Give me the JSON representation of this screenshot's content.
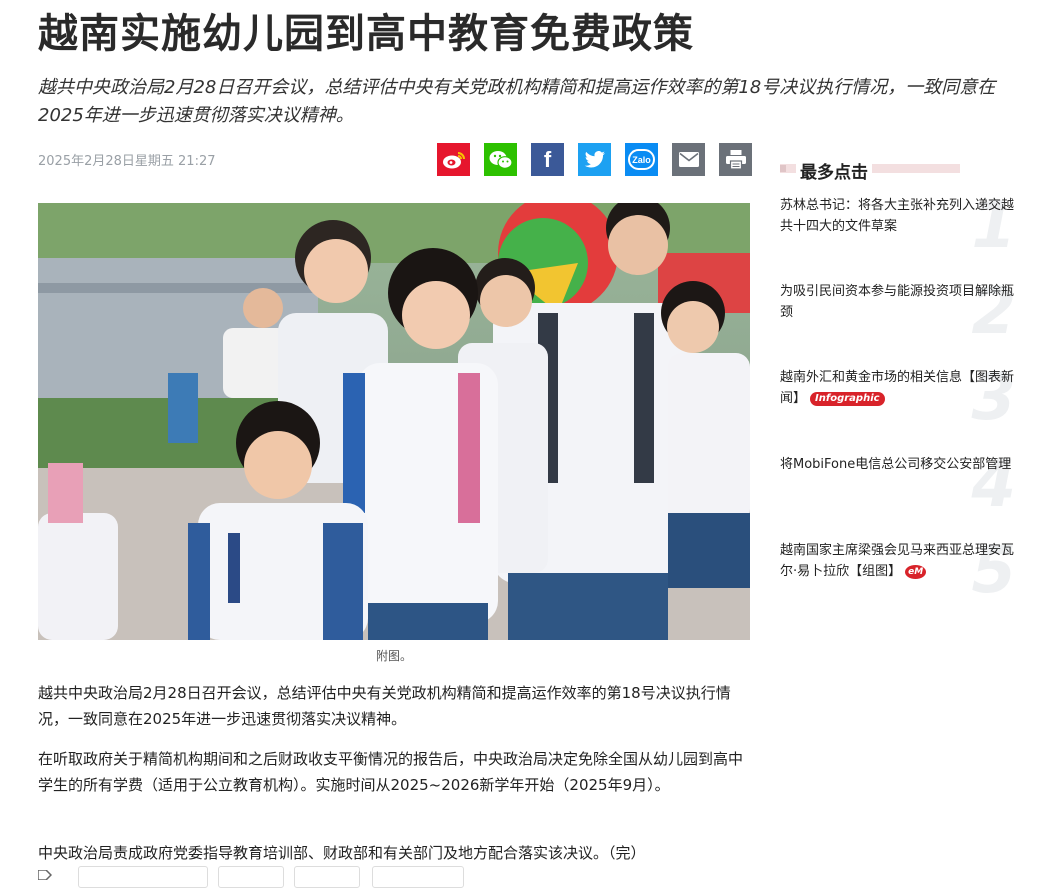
{
  "article": {
    "title": "越南实施幼儿园到高中教育免费政策",
    "sapo": "越共中央政治局2月28日召开会议，总结评估中央有关党政机构精简和提高运作效率的第18号决议执行情况，一致同意在2025年进一步迅速贯彻落实决议精神。",
    "date": "2025年2月28日星期五 21:27",
    "photo_caption": "附图。",
    "paragraphs": [
      "越共中央政治局2月28日召开会议，总结评估中央有关党政机构精简和提高运作效率的第18号决议执行情况，一致同意在2025年进一步迅速贯彻落实决议精神。",
      "在听取政府关于精简机构期间和之后财政收支平衡情况的报告后，中央政治局决定免除全国从幼儿园到高中学生的所有学费（适用于公立教育机构）。实施时间从2025~2026新学年开始（2025年9月）。",
      "中央政治局责成政府党委指导教育培训部、财政部和有关部门及地方配合落实该决议。（完）"
    ]
  },
  "share": {
    "weibo": "weibo",
    "wechat": "wechat",
    "facebook": "f",
    "twitter": "twitter",
    "zalo": "Zalo",
    "email": "email",
    "print": "print"
  },
  "colors": {
    "weibo": "#e6162d",
    "wechat": "#2dc100",
    "facebook": "#3b5998",
    "twitter": "#1da1f2",
    "zalo": "#0a8cf3",
    "email": "#6b7179",
    "print": "#6b7179",
    "badge": "#d8232a"
  },
  "sidebar": {
    "heading": "最多点击",
    "items": [
      {
        "num": "1",
        "title": "苏林总书记：将各大主张补充列入递交越共十四大的文件草案",
        "badge": ""
      },
      {
        "num": "2",
        "title": "为吸引民间资本参与能源投资项目解除瓶颈",
        "badge": ""
      },
      {
        "num": "3",
        "title": "越南外汇和黄金市场的相关信息【图表新闻】",
        "badge": "Infographic"
      },
      {
        "num": "4",
        "title": "将MobiFone电信总公司移交公安部管理",
        "badge": ""
      },
      {
        "num": "5",
        "title": "越南国家主席梁强会见马来西亚总理安瓦尔·易卜拉欣【组图】",
        "badge": "eM"
      }
    ]
  }
}
